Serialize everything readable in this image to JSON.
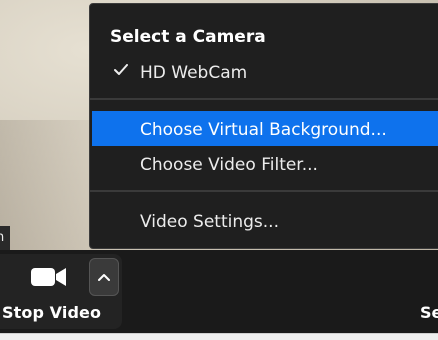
{
  "camera_menu": {
    "header": "Select a Camera",
    "cameras": [
      {
        "label": "HD WebCam",
        "selected": true
      }
    ],
    "items": [
      {
        "label": "Choose Virtual Background...",
        "highlighted": true
      },
      {
        "label": "Choose Video Filter...",
        "highlighted": false
      },
      {
        "label": "Video Settings...",
        "highlighted": false
      }
    ],
    "highlight_color": "#0e72ed"
  },
  "toolbar": {
    "stop_video_label": "Stop Video",
    "next_label_fragment": "Se",
    "video_icon": "video-camera-icon",
    "options_icon": "chevron-up-icon"
  },
  "video": {
    "name_tag_fragment": "n"
  }
}
